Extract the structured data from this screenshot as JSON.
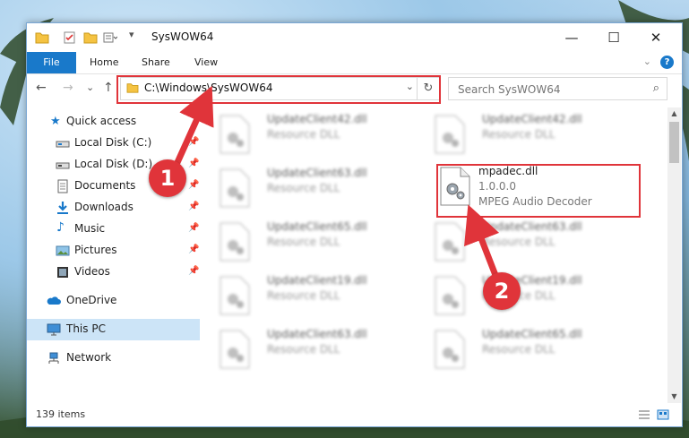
{
  "window": {
    "title": "SysWOW64",
    "controls": {
      "minimize": "—",
      "maximize": "☐",
      "close": "✕"
    }
  },
  "ribbon": {
    "tabs": [
      {
        "label": "File"
      },
      {
        "label": "Home"
      },
      {
        "label": "Share"
      },
      {
        "label": "View"
      }
    ],
    "help_label": "?"
  },
  "navigation": {
    "back": "←",
    "forward": "→",
    "recent": "⌄",
    "up": "↑",
    "address": "C:\\Windows\\SysWOW64",
    "search_placeholder": "Search SysWOW64"
  },
  "sidebar": {
    "items": [
      {
        "label": "Quick access",
        "icon": "star-icon",
        "pinned": false
      },
      {
        "label": "Local Disk (C:)",
        "icon": "drive-icon",
        "pinned": true
      },
      {
        "label": "Local Disk (D:)",
        "icon": "drive-icon",
        "pinned": true
      },
      {
        "label": "Documents",
        "icon": "document-icon",
        "pinned": true
      },
      {
        "label": "Downloads",
        "icon": "download-icon",
        "pinned": true
      },
      {
        "label": "Music",
        "icon": "music-icon",
        "pinned": true
      },
      {
        "label": "Pictures",
        "icon": "pictures-icon",
        "pinned": true
      },
      {
        "label": "Videos",
        "icon": "video-icon",
        "pinned": true
      },
      {
        "label": "OneDrive",
        "icon": "cloud-icon",
        "pinned": false
      },
      {
        "label": "This PC",
        "icon": "computer-icon",
        "pinned": false,
        "selected": true
      },
      {
        "label": "Network",
        "icon": "network-icon",
        "pinned": false
      }
    ]
  },
  "files": [
    {
      "name": "UpdateClient42.dll",
      "desc": "Resource DLL"
    },
    {
      "name": "UpdateClient42.dll",
      "desc": "Resource DLL"
    },
    {
      "name": "UpdateClient63.dll",
      "desc": "Resource DLL"
    },
    {
      "name": "UpdateClient65.dll",
      "desc": "Resource DLL"
    },
    {
      "name": "UpdateClient63.dll",
      "desc": "Resource DLL"
    },
    {
      "name": "UpdateClient19.dll",
      "desc": "Resource DLL"
    },
    {
      "name": "UpdateClient19.dll",
      "desc": "Resource DLL"
    },
    {
      "name": "UpdateClient63.dll",
      "desc": "Resource DLL"
    },
    {
      "name": "UpdateClient65.dll",
      "desc": "Resource DLL"
    }
  ],
  "highlighted_file": {
    "name": "mpadec.dll",
    "version": "1.0.0.0",
    "desc": "MPEG Audio Decoder"
  },
  "status": {
    "item_count": "139 items"
  },
  "callouts": [
    {
      "label": "1"
    },
    {
      "label": "2"
    }
  ],
  "colors": {
    "accent": "#1979ca",
    "highlight": "#e0343a",
    "selected": "#cce4f7"
  }
}
